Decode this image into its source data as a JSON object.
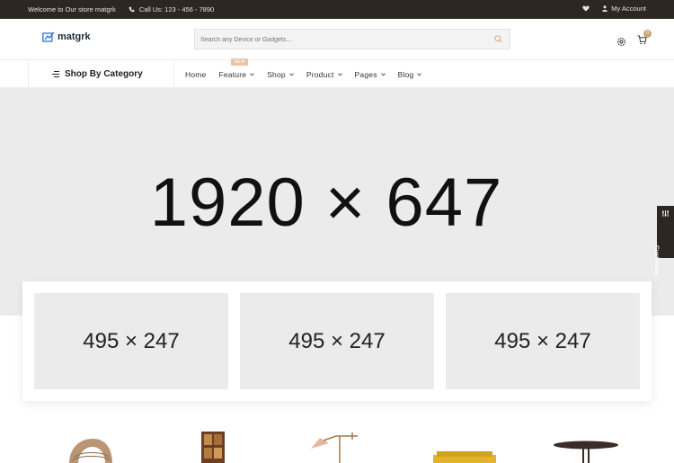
{
  "topbar": {
    "welcome": "Welcome to Our store matgrk",
    "phone": "Call Us: 123 - 456 - 7890",
    "account": "My Account"
  },
  "header": {
    "logo": "matgrk",
    "search_placeholder": "Search any Device or Gadgets...",
    "cart_count": "0"
  },
  "nav": {
    "category": "Shop By Category",
    "items": [
      {
        "label": "Home"
      },
      {
        "label": "Feature",
        "badge": "NEW"
      },
      {
        "label": "Shop"
      },
      {
        "label": "Product"
      },
      {
        "label": "Pages"
      },
      {
        "label": "Blog"
      }
    ]
  },
  "hero": {
    "placeholder": "1920 × 647"
  },
  "banners": [
    {
      "label": "495 × 247"
    },
    {
      "label": "495 × 247"
    },
    {
      "label": "495 × 247"
    }
  ],
  "customize": "Customize",
  "colors": {
    "topbar": "#2c2722",
    "accent": "#c9a27a",
    "placeholder_bg": "#ebebeb"
  }
}
